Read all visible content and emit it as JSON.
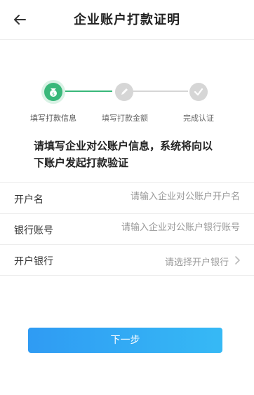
{
  "header": {
    "title": "企业账户打款证明",
    "back_icon": "back-arrow-icon"
  },
  "steps": [
    {
      "label": "填写打款信息",
      "icon": "money-bag-icon",
      "status": "active"
    },
    {
      "label": "填写打款金额",
      "icon": "pencil-icon",
      "status": "pending"
    },
    {
      "label": "完成认证",
      "icon": "check-icon",
      "status": "pending"
    }
  ],
  "intro": {
    "line1": "请填写企业对公账户信息，系统将向以",
    "line2": "下账户发起打款验证"
  },
  "form": {
    "account_name": {
      "label": "开户名",
      "placeholder": "请输入企业对公账户开户名"
    },
    "bank_account": {
      "label": "银行账号",
      "placeholder": "请输入企业对公账户银行账号"
    },
    "bank": {
      "label": "开户银行",
      "value": "请选择开户银行"
    }
  },
  "next_button": {
    "label": "下一步"
  },
  "colors": {
    "active_green": "#39b87a",
    "inactive_gray": "#cfcfcf",
    "button_blue": "#2f9bf3"
  }
}
